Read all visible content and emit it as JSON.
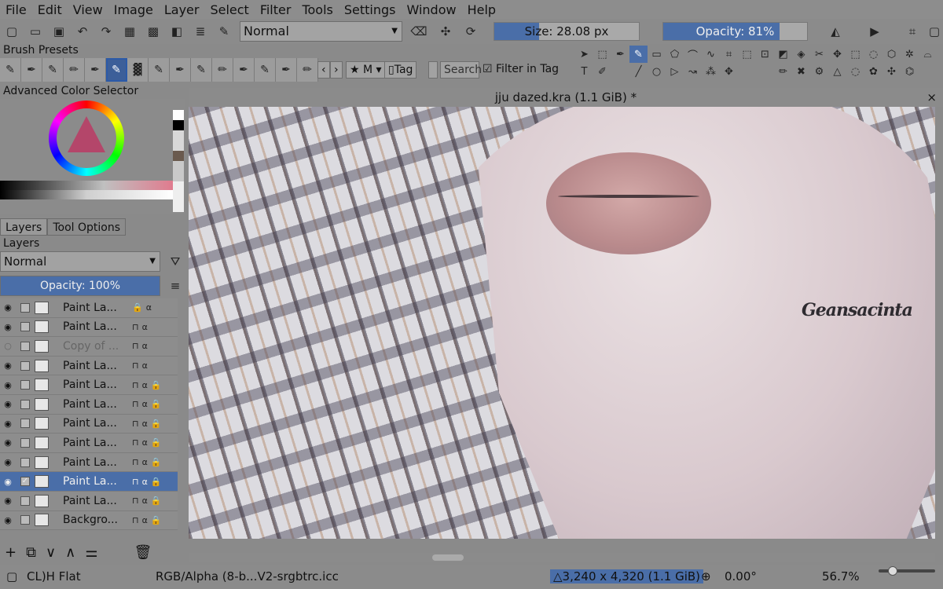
{
  "menu": [
    "File",
    "Edit",
    "View",
    "Image",
    "Layer",
    "Select",
    "Filter",
    "Tools",
    "Settings",
    "Window",
    "Help"
  ],
  "toolbar": {
    "blend_mode": "Normal",
    "size_label": "Size: 28.08 px",
    "size_fill": 0.31,
    "opacity_label": "Opacity: 81%",
    "opacity_fill": 0.81
  },
  "brush_presets": {
    "title": "Brush Presets",
    "tag_button": "★ M",
    "tag_label": "Tag",
    "search_placeholder": "Search",
    "filter_label": "Filter in Tag"
  },
  "color_selector": {
    "title": "Advanced Color Selector"
  },
  "tabs": [
    "Layers",
    "Tool Options"
  ],
  "layers_panel": {
    "title": "Layers",
    "blend_mode": "Normal",
    "opacity_label": "Opacity: 100%",
    "items": [
      {
        "name": "Paint La...",
        "visible": true,
        "checked": false,
        "locked": true,
        "selected": false
      },
      {
        "name": "Paint La...",
        "visible": true,
        "checked": false,
        "locked": false,
        "selected": false
      },
      {
        "name": "Copy of ...",
        "visible": false,
        "checked": false,
        "locked": false,
        "selected": false
      },
      {
        "name": "Paint La...",
        "visible": true,
        "checked": false,
        "locked": false,
        "selected": false
      },
      {
        "name": "Paint La...",
        "visible": true,
        "checked": false,
        "locked": false,
        "selected": false
      },
      {
        "name": "Paint La...",
        "visible": true,
        "checked": false,
        "locked": false,
        "selected": false
      },
      {
        "name": "Paint La...",
        "visible": true,
        "checked": false,
        "locked": false,
        "selected": false
      },
      {
        "name": "Paint La...",
        "visible": true,
        "checked": false,
        "locked": false,
        "selected": false
      },
      {
        "name": "Paint La...",
        "visible": true,
        "checked": false,
        "locked": false,
        "selected": false
      },
      {
        "name": "Paint La...",
        "visible": true,
        "checked": true,
        "locked": false,
        "selected": true
      },
      {
        "name": "Paint La...",
        "visible": true,
        "checked": false,
        "locked": false,
        "selected": false
      },
      {
        "name": "Backgro...",
        "visible": true,
        "checked": false,
        "locked": false,
        "selected": false
      }
    ]
  },
  "document": {
    "title": "jju dazed.kra (1.1 GiB) *",
    "signature": "Geansacinta"
  },
  "status": {
    "brush": "CL)H Flat",
    "color_profile": "RGB/Alpha (8-b...V2-srgbtrc.icc",
    "dimensions": "3,240 x 4,320 (1.1 GiB)",
    "rotation": "0.00°",
    "zoom": "56.7%"
  },
  "colors": {
    "accent": "#4a6ea8",
    "panel": "#8b8b8b"
  }
}
